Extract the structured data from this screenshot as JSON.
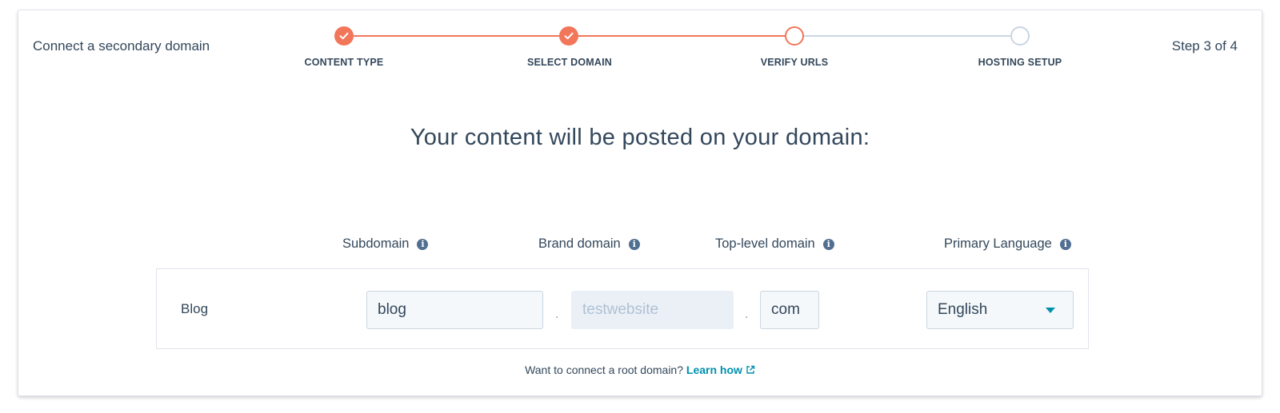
{
  "header": {
    "title": "Connect a secondary domain",
    "step_count": "Step 3 of 4"
  },
  "stepper": {
    "steps": [
      {
        "label": "CONTENT TYPE",
        "state": "done"
      },
      {
        "label": "SELECT DOMAIN",
        "state": "done"
      },
      {
        "label": "VERIFY URLS",
        "state": "active"
      },
      {
        "label": "HOSTING SETUP",
        "state": "todo"
      }
    ]
  },
  "main": {
    "headline": "Your content will be posted on your domain:",
    "columns": {
      "subdomain": "Subdomain",
      "brand_domain": "Brand domain",
      "top_level_domain": "Top-level domain",
      "primary_language": "Primary Language"
    },
    "row": {
      "label": "Blog",
      "subdomain_value": "blog",
      "brand_domain_placeholder": "testwebsite",
      "top_level_domain_value": "com",
      "language_value": "English",
      "separator": "."
    },
    "footer": {
      "question": "Want to connect a root domain?",
      "link": "Learn how"
    }
  },
  "colors": {
    "accent": "#f2765a",
    "link": "#0091ae",
    "text": "#33475b",
    "inactive": "#cbd6e2"
  },
  "icons": {
    "done_step": "check-icon",
    "info": "info-icon",
    "external": "external-link-icon",
    "dropdown": "caret-down-icon"
  }
}
